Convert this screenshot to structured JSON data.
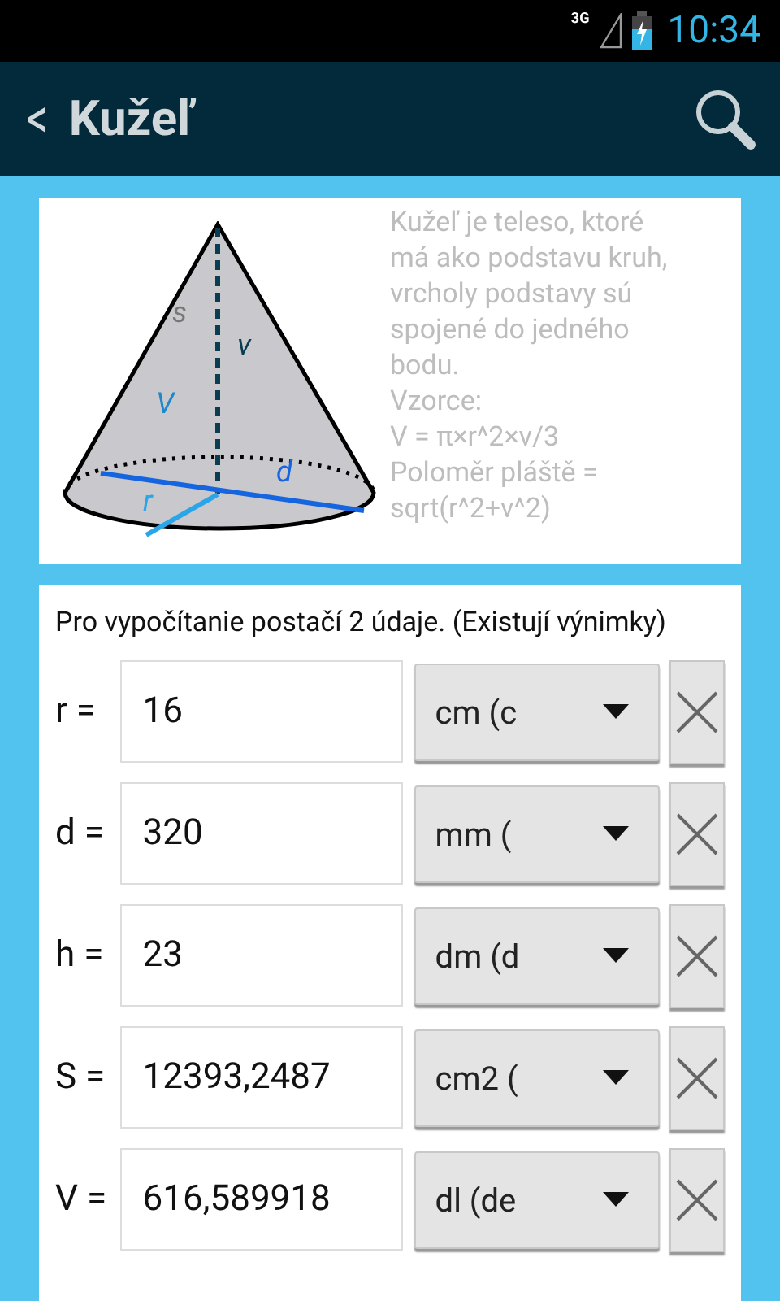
{
  "status_bar": {
    "network": "3G",
    "time": "10:34"
  },
  "action_bar": {
    "back": "<",
    "title": "Kužeľ"
  },
  "figure": {
    "labels": [
      {
        "kind": "slant",
        "text": "s"
      },
      {
        "kind": "height",
        "text": "v"
      },
      {
        "kind": "volume",
        "text": "V"
      },
      {
        "kind": "diameter",
        "text": "d"
      },
      {
        "kind": "radius",
        "text": "r"
      }
    ],
    "description_lines": [
      "Kužeľ je teleso, ktoré",
      "má ako podstavu kruh,",
      "vrcholy podstavy sú",
      "spojené do jedného",
      "bodu.",
      "Vzorce:",
      "V = π×r^2×v/3",
      "Poloměr pláště =",
      "sqrt(r^2+v^2)"
    ]
  },
  "form": {
    "hint": "Pro vypočítanie postačí 2 údaje. (Existují výnimky)",
    "rows": [
      {
        "label": "r =",
        "value": "16",
        "unit": "cm (c"
      },
      {
        "label": "d =",
        "value": "320",
        "unit": "mm ("
      },
      {
        "label": "h =",
        "value": "23",
        "unit": "dm (d"
      },
      {
        "label": "S =",
        "value": "12393,2487",
        "unit": "cm2 ("
      },
      {
        "label": "V =",
        "value": "616,589918",
        "unit": "dl (de"
      }
    ]
  }
}
